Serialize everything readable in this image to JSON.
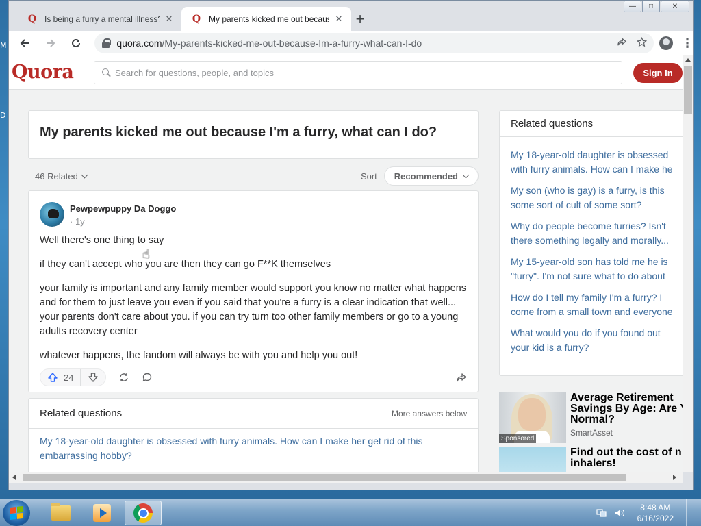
{
  "desktop": {
    "fragments": [
      "M",
      "D"
    ]
  },
  "browser": {
    "tabs": [
      {
        "title": "Is being a furry a mental illness? - Quora",
        "favicon": "Q",
        "active": false
      },
      {
        "title": "My parents kicked me out because I'm a furry, what can I do? - Quora",
        "favicon": "Q",
        "active": true
      }
    ],
    "new_tab_icon": "+",
    "window_controls": {
      "minimize": "—",
      "maximize": "□",
      "close": "✕"
    },
    "url": {
      "host": "quora.com",
      "path": "/My-parents-kicked-me-out-because-Im-a-furry-what-can-I-do"
    }
  },
  "quora": {
    "logo": "Quora",
    "search_placeholder": "Search for questions, people, and topics",
    "sign_in": "Sign In",
    "question": "My parents kicked me out because I'm a furry, what can I do?",
    "related_count": "46 Related",
    "sort_label": "Sort",
    "sort_value": "Recommended",
    "answer": {
      "author": "Pewpewpuppy Da Doggo",
      "time": "· 1y",
      "paragraphs": [
        "Well there's one thing to say",
        "if they can't accept who you are then they can go F**K themselves",
        "your family is important and any family member would support you know no matter what happens and for them to just leave you even if you said that you're a furry is a clear indication that well... your parents don't care about you. if you can try turn too other family members or go to a young adults recovery center",
        "whatever happens, the fandom will always be with you and help you out!"
      ],
      "upvotes": "24"
    },
    "related_inline": {
      "title": "Related questions",
      "more": "More answers below",
      "items": [
        "My 18-year-old daughter is obsessed with furry animals. How can I make her get rid of this embarrassing hobby?"
      ]
    },
    "sidebar": {
      "title": "Related questions",
      "items": [
        [
          "My 18-year-old daughter is obsessed",
          "with furry animals. How can I make he"
        ],
        [
          "My son (who is gay) is a furry, is this",
          "some sort of cult of some sort?"
        ],
        [
          "Why do people become furries? Isn't",
          "there something legally and morally..."
        ],
        [
          "My 15-year-old son has told me he is",
          "\"furry\". I'm not sure what to do about"
        ],
        [
          "How do I tell my family I'm a furry? I",
          "come from a small town and everyone"
        ],
        [
          "What would you do if you found out",
          "your kid is a furry?"
        ]
      ]
    },
    "ads": [
      {
        "title": "Average Retirement Savings By Age: Are Y Normal?",
        "source": "SmartAsset",
        "badge": "Sponsored"
      },
      {
        "title": "Find out the cost of n inhalers!",
        "source": ""
      }
    ]
  },
  "taskbar": {
    "time": "8:48 AM",
    "date": "6/16/2022"
  }
}
